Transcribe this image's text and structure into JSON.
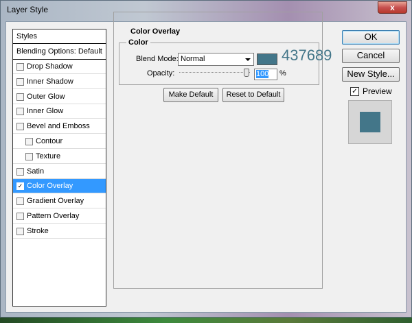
{
  "window": {
    "title": "Layer Style",
    "close_label": "x"
  },
  "styles_panel": {
    "header": "Styles",
    "blending_options": "Blending Options: Default",
    "items": [
      {
        "label": "Drop Shadow",
        "checked": false,
        "indent": false,
        "selected": false
      },
      {
        "label": "Inner Shadow",
        "checked": false,
        "indent": false,
        "selected": false
      },
      {
        "label": "Outer Glow",
        "checked": false,
        "indent": false,
        "selected": false
      },
      {
        "label": "Inner Glow",
        "checked": false,
        "indent": false,
        "selected": false
      },
      {
        "label": "Bevel and Emboss",
        "checked": false,
        "indent": false,
        "selected": false
      },
      {
        "label": "Contour",
        "checked": false,
        "indent": true,
        "selected": false
      },
      {
        "label": "Texture",
        "checked": false,
        "indent": true,
        "selected": false
      },
      {
        "label": "Satin",
        "checked": false,
        "indent": false,
        "selected": false
      },
      {
        "label": "Color Overlay",
        "checked": true,
        "indent": false,
        "selected": true
      },
      {
        "label": "Gradient Overlay",
        "checked": false,
        "indent": false,
        "selected": false
      },
      {
        "label": "Pattern Overlay",
        "checked": false,
        "indent": false,
        "selected": false
      },
      {
        "label": "Stroke",
        "checked": false,
        "indent": false,
        "selected": false
      }
    ]
  },
  "color_overlay": {
    "group_title": "Color Overlay",
    "sub_group_title": "Color",
    "blend_mode_label": "Blend Mode:",
    "blend_mode_value": "Normal",
    "color_hex": "#437689",
    "color_note": "437689",
    "opacity_label": "Opacity:",
    "opacity_value": "100",
    "opacity_unit": "%",
    "make_default_label": "Make Default",
    "reset_default_label": "Reset to Default"
  },
  "buttons": {
    "ok": "OK",
    "cancel": "Cancel",
    "new_style": "New Style..."
  },
  "preview": {
    "label": "Preview",
    "checked": true,
    "swatch_color": "#437689"
  },
  "colors": {
    "accent": "#3399ff",
    "note_text": "#437689"
  }
}
